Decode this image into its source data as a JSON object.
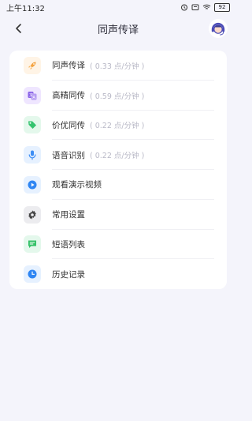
{
  "status": {
    "time": "上午11:32",
    "battery": "92"
  },
  "header": {
    "title": "同声传译"
  },
  "menu": [
    {
      "label": "同声传译",
      "price": "( 0.33 点/分钟 )",
      "icon": "rocket-icon",
      "bg": "#fff4e6",
      "fg": "#f4a340"
    },
    {
      "label": "高精同传",
      "price": "( 0.59 点/分钟 )",
      "icon": "translate-icon",
      "bg": "#efe6ff",
      "fg": "#8a63e8"
    },
    {
      "label": "价优同传",
      "price": "( 0.22 点/分钟 )",
      "icon": "tag-icon",
      "bg": "#e4f8ec",
      "fg": "#35c36f"
    },
    {
      "label": "语音识别",
      "price": "( 0.22 点/分钟 )",
      "icon": "microphone-icon",
      "bg": "#e6f1ff",
      "fg": "#3d8ef5"
    },
    {
      "label": "观看演示视频",
      "price": "",
      "icon": "play-icon",
      "bg": "#e6f1ff",
      "fg": "#2f86f3"
    },
    {
      "label": "常用设置",
      "price": "",
      "icon": "gear-icon",
      "bg": "#ececef",
      "fg": "#444"
    },
    {
      "label": "短语列表",
      "price": "",
      "icon": "chat-icon",
      "bg": "#e4f8ec",
      "fg": "#33c167"
    },
    {
      "label": "历史记录",
      "price": "",
      "icon": "clock-icon",
      "bg": "#e6f1ff",
      "fg": "#2f86f3"
    }
  ]
}
